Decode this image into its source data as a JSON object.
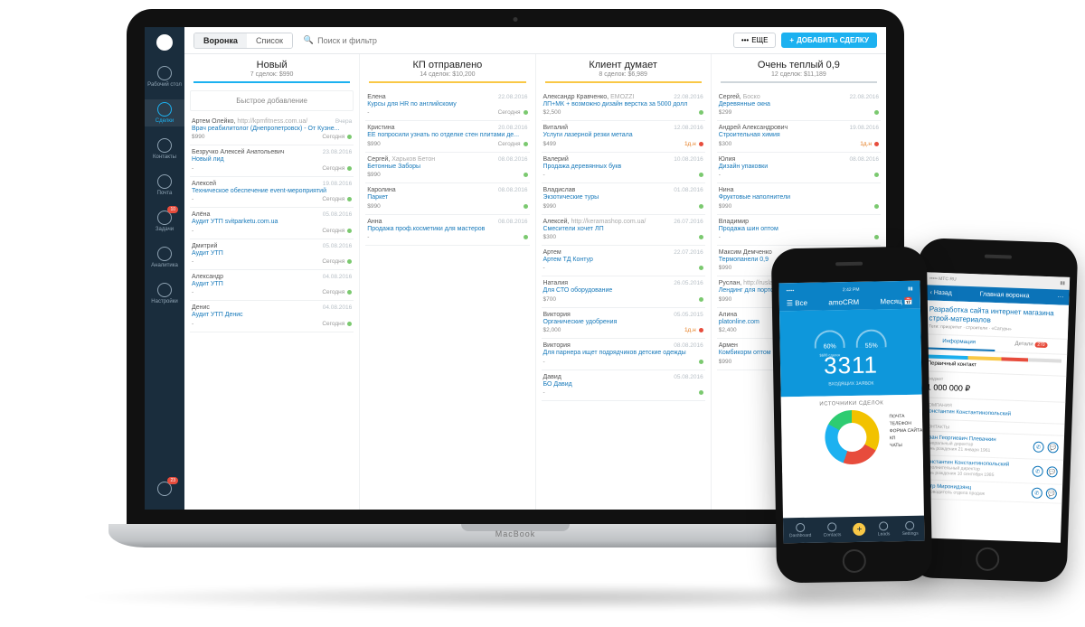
{
  "topbar": {
    "view_funnel": "Воронка",
    "view_list": "Список",
    "search_placeholder": "Поиск и фильтр",
    "more": "ЕЩЕ",
    "add": "ДОБАВИТЬ СДЕЛКУ"
  },
  "sidebar": {
    "items": [
      {
        "label": "Рабочий стол"
      },
      {
        "label": "Сделки"
      },
      {
        "label": "Контакты"
      },
      {
        "label": "Почта"
      },
      {
        "label": "Задачи",
        "badge": "10"
      },
      {
        "label": "Аналитика"
      },
      {
        "label": "Настройки"
      }
    ],
    "bottom_badge": "23"
  },
  "columns": [
    {
      "title": "Новый",
      "subtitle": "7 сделок: $990",
      "quick_add": "Быстрое добавление",
      "cards": [
        {
          "who": "Артем Олейко,",
          "extra": "http://kpmfitness.com.ua/",
          "date": "Вчера",
          "title": "Врач реабилитолог (Днепропетровск) - От Кузне...",
          "amount": "$990",
          "tag": "Сегодня"
        },
        {
          "who": "Безручко Алексей Анатольевич",
          "date": "23.08.2016",
          "title": "Новый лид",
          "amount": "-",
          "tag": "Сегодня"
        },
        {
          "who": "Алексей",
          "date": "19.08.2016",
          "title": "Техническое обеспечение event-мероприятий",
          "amount": "-",
          "tag": "Сегодня"
        },
        {
          "who": "Алёна",
          "date": "05.08.2016",
          "title": "Аудит УТП svitparketu.com.ua",
          "amount": "-",
          "tag": "Сегодня"
        },
        {
          "who": "Дмитрий",
          "date": "05.08.2016",
          "title": "Аудит УТП",
          "amount": "-",
          "tag": "Сегодня"
        },
        {
          "who": "Александр",
          "date": "04.08.2016",
          "title": "Аудит УТП",
          "amount": "-",
          "tag": "Сегодня"
        },
        {
          "who": "Денис",
          "date": "04.08.2016",
          "title": "Аудит УТП Денис",
          "amount": "-",
          "tag": "Сегодня"
        }
      ]
    },
    {
      "title": "КП отправлено",
      "subtitle": "14 сделок: $10,200",
      "cards": [
        {
          "who": "Елена",
          "date": "22.08.2016",
          "title": "Курсы для HR по английскому",
          "amount": "-",
          "tag": "Сегодня"
        },
        {
          "who": "Кристина",
          "date": "20.08.2016",
          "title": "ЕЕ попросили узнать по отделке стен плитами де...",
          "amount": "$990",
          "tag": "Сегодня"
        },
        {
          "who": "Сергей,",
          "extra": "Харьков Бетон",
          "date": "08.08.2016",
          "title": "Бетонные Заборы",
          "amount": "$990",
          "tag": ""
        },
        {
          "who": "Каролина",
          "date": "08.08.2016",
          "title": "Паркет",
          "amount": "$990",
          "tag": ""
        },
        {
          "who": "Анна",
          "date": "08.08.2016",
          "title": "Продажа проф.косметики для мастеров",
          "amount": "-",
          "tag": ""
        }
      ]
    },
    {
      "title": "Клиент думает",
      "subtitle": "8 сделок: $6,989",
      "cards": [
        {
          "who": "Александр Кравченко,",
          "extra": "EMOZZI",
          "date": "22.08.2016",
          "title": "ЛП+МК + возможно дизайн верстка за 5000 долл",
          "amount": "$2,500",
          "tag": ""
        },
        {
          "who": "Виталий",
          "date": "12.08.2016",
          "title": "Услуги лазерной резки метала",
          "amount": "$499",
          "tag": "1д.н",
          "warn": true
        },
        {
          "who": "Валерий",
          "date": "10.08.2016",
          "title": "Продажа деревянных букв",
          "amount": "-",
          "tag": ""
        },
        {
          "who": "Владислав",
          "date": "01.08.2016",
          "title": "Экзотические туры",
          "amount": "$990",
          "tag": ""
        },
        {
          "who": "Алексей,",
          "extra": "http://keramashop.com.ua/",
          "date": "26.07.2016",
          "title": "Смесители хочет ЛП",
          "amount": "$300",
          "tag": ""
        },
        {
          "who": "Артем",
          "date": "22.07.2016",
          "title": "Артем ТД Контур",
          "amount": "-",
          "tag": ""
        },
        {
          "who": "Наталия",
          "date": "26.05.2016",
          "title": "Для СТО оборудование",
          "amount": "$700",
          "tag": ""
        },
        {
          "who": "Виктория",
          "date": "05.05.2015",
          "title": "Органические удобрения",
          "amount": "$2,000",
          "tag": "1д.н",
          "warn": true
        },
        {
          "who": "Виктория",
          "date": "08.08.2016",
          "title": "Для парнера ищет подрядчиков детские одежды",
          "amount": "-",
          "tag": ""
        },
        {
          "who": "Давид",
          "date": "05.08.2016",
          "title": "БО Давид",
          "amount": "-",
          "tag": ""
        }
      ]
    },
    {
      "title": "Очень теплый 0,9",
      "subtitle": "12 сделок: $11,189",
      "cards": [
        {
          "who": "Сергей,",
          "extra": "Боско",
          "date": "22.08.2016",
          "title": "Деревянные окна",
          "amount": "$299",
          "tag": ""
        },
        {
          "who": "Андрей Александрович",
          "date": "19.08.2016",
          "title": "Строительная химия",
          "amount": "$300",
          "tag": "1д.н",
          "warn": true
        },
        {
          "who": "Юлия",
          "date": "08.08.2016",
          "title": "Дизайн упаковки",
          "amount": "-",
          "tag": ""
        },
        {
          "who": "Нина",
          "date": "",
          "title": "Фруктовые наполнители",
          "amount": "$990",
          "tag": ""
        },
        {
          "who": "Владимир",
          "date": "",
          "title": "Продажа шин оптом",
          "amount": "-",
          "tag": ""
        },
        {
          "who": "Максим Демченко",
          "date": "",
          "title": "Термопанели 0,9",
          "amount": "$990",
          "tag": ""
        },
        {
          "who": "Руслан,",
          "extra": "http://ruslanklian.wix",
          "date": "",
          "title": "Лендинг для портфолио ху...",
          "amount": "$990",
          "tag": ""
        },
        {
          "who": "Алина",
          "date": "",
          "title": "platonline.com",
          "amount": "$2,400",
          "tag": ""
        },
        {
          "who": "Армен",
          "date": "",
          "title": "Комбикорм оптом",
          "amount": "$990",
          "tag": ""
        }
      ]
    }
  ],
  "laptop_brand": "MacBook",
  "phone1": {
    "status_time": "2:42 PM",
    "app": "amoCRM",
    "left": "Все",
    "right": "Месяц",
    "big": "3311",
    "big_sub": "ВХОДЯЩИХ ЗАЯВОК",
    "gauges": [
      {
        "v": "60%",
        "l": "$600 сделок"
      },
      {
        "v": "55%",
        "l": ""
      }
    ],
    "src_title": "ИСТОЧНИКИ СДЕЛОК",
    "legend": [
      "ПОЧТА",
      "ТЕЛЕФОН",
      "ФОРМА САЙТА",
      "КП",
      "ЧАТЫ"
    ],
    "tabs": [
      "Dashboard",
      "Contacts",
      "",
      "Leads",
      "Settings"
    ]
  },
  "phone2": {
    "nav_back": "Назад",
    "nav_title": "Главная воронка",
    "nav_right": "···",
    "title": "Разработка сайта интернет магазина строй-материалов",
    "sub": "Теги: приоритет · строители · «Сатурн»",
    "tabs": [
      "Информация",
      "Детали"
    ],
    "tab_badge": "270",
    "stage_label": "Первичный контакт",
    "budget_label": "Бюджет",
    "budget": "1 000 000 ₽",
    "company_label": "КОМПАНИЯ",
    "company": "Константин Константинопольский",
    "contacts_label": "КОНТАКТЫ",
    "contacts": [
      {
        "name": "Иван Георгиевич Плевачкин",
        "role": "Генеральный директор",
        "meta": "День рождения 21 января 1961"
      },
      {
        "name": "Константин Константинопольский",
        "role": "Исполнительный директор",
        "meta": "День рождения 10 сентября 1985"
      },
      {
        "name": "Петр Миронидзянц",
        "role": "Руководитель отдела продаж",
        "meta": ""
      }
    ]
  }
}
